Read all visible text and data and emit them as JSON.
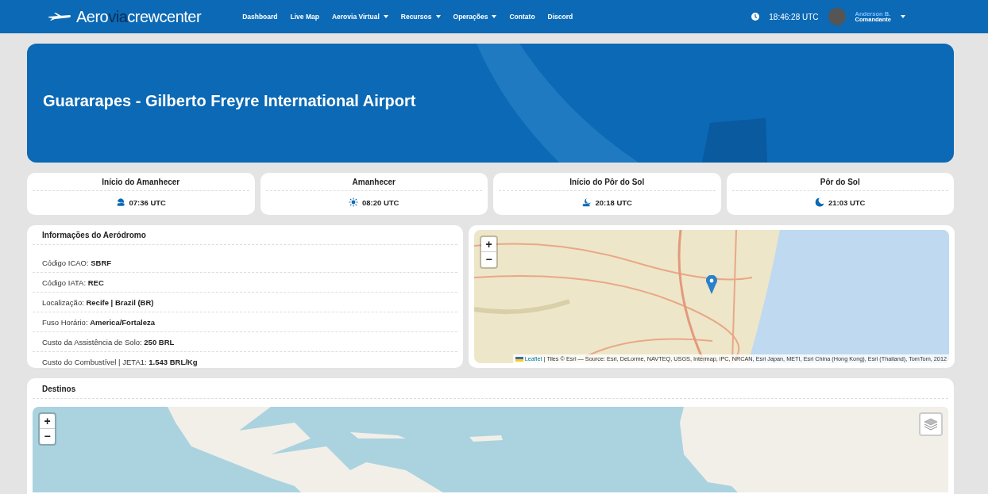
{
  "navbar": {
    "logo": [
      {
        "text": "Aero",
        "highlighted": false
      },
      {
        "text": "via",
        "highlighted": true
      },
      {
        "text": "crewcenter",
        "highlighted": false
      }
    ],
    "items": [
      {
        "label": "Dashboard",
        "kind": "link"
      },
      {
        "label": "Live Map",
        "kind": "link"
      },
      {
        "label": "Aerovia Virtual",
        "kind": "dropdown"
      },
      {
        "label": "Recursos",
        "kind": "dropdown"
      },
      {
        "label": "Operações",
        "kind": "dropdown"
      },
      {
        "label": "Contato",
        "kind": "link"
      },
      {
        "label": "Discord",
        "kind": "link"
      }
    ],
    "clock": "18:46:28 UTC",
    "user": {
      "name": "Anderson B.",
      "role": "Comandante"
    }
  },
  "hero": {
    "title": "Guararapes - Gilberto Freyre International Airport"
  },
  "sun_times": [
    {
      "title": "Início do Amanhecer",
      "time": "07:36 UTC",
      "kind": "dawn-start"
    },
    {
      "title": "Amanhecer",
      "time": "08:20 UTC",
      "kind": "dawn"
    },
    {
      "title": "Início do Pôr do Sol",
      "time": "20:18 UTC",
      "kind": "dusk-start"
    },
    {
      "title": "Pôr do Sol",
      "time": "21:03 UTC",
      "kind": "dusk"
    }
  ],
  "aerodrome_info": {
    "title": "Informações do Aeródromo",
    "rows": [
      {
        "label": "Código ICAO:",
        "value": "SBRF"
      },
      {
        "label": "Código IATA:",
        "value": "REC"
      },
      {
        "label": "Localização:",
        "value": "Recife | Brazil (BR)"
      },
      {
        "label": "Fuso Horário:",
        "value": "America/Fortaleza"
      },
      {
        "label": "Custo da Assistência de Solo:",
        "value": "250 BRL"
      },
      {
        "label": "Custo do Combustível | JETA1:",
        "value": "1.543 BRL/Kg"
      }
    ]
  },
  "airport_map": {
    "zoom_in": "+",
    "zoom_out": "−",
    "attribution_link": "Leaflet",
    "attribution": "| Tiles © Esri — Source: Esri, DeLorme, NAVTEQ, USGS, Intermap, iPC, NRCAN, Esri Japan, METI, Esri China (Hong Kong), Esri (Thailand), TomTom, 2012"
  },
  "destinations": {
    "title": "Destinos",
    "zoom_in": "+",
    "zoom_out": "−"
  }
}
